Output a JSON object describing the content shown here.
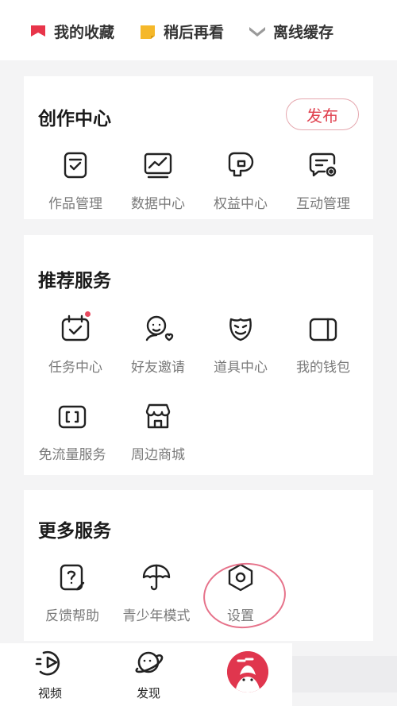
{
  "quick_links": [
    {
      "label": "我的收藏",
      "icon": "bookmark-icon",
      "color": "#e8354a"
    },
    {
      "label": "稍后再看",
      "icon": "watch-later-icon",
      "color": "#f5b82a"
    },
    {
      "label": "离线缓存",
      "icon": "offline-download-icon",
      "color": "#9a9a9a"
    }
  ],
  "creation": {
    "title": "创作中心",
    "publish_label": "发布",
    "items": [
      {
        "label": "作品管理",
        "icon": "works-manage-icon"
      },
      {
        "label": "数据中心",
        "icon": "data-chart-icon"
      },
      {
        "label": "权益中心",
        "icon": "benefits-icon"
      },
      {
        "label": "互动管理",
        "icon": "interaction-settings-icon"
      }
    ]
  },
  "recommended": {
    "title": "推荐服务",
    "items": [
      {
        "label": "任务中心",
        "icon": "task-calendar-icon"
      },
      {
        "label": "好友邀请",
        "icon": "invite-friend-icon"
      },
      {
        "label": "道具中心",
        "icon": "props-mask-icon"
      },
      {
        "label": "我的钱包",
        "icon": "wallet-icon"
      },
      {
        "label": "免流量服务",
        "icon": "data-free-sim-icon"
      },
      {
        "label": "周边商城",
        "icon": "store-icon"
      }
    ]
  },
  "more": {
    "title": "更多服务",
    "items": [
      {
        "label": "反馈帮助",
        "icon": "feedback-help-icon"
      },
      {
        "label": "青少年模式",
        "icon": "teen-mode-umbrella-icon"
      },
      {
        "label": "设置",
        "icon": "settings-hexagon-icon"
      }
    ]
  },
  "tabbar": {
    "items": [
      {
        "label": "视频",
        "icon": "video-play-icon"
      },
      {
        "label": "发现",
        "icon": "discover-planet-icon"
      },
      {
        "label": "",
        "icon": "avatar-icon"
      }
    ]
  },
  "colors": {
    "accent": "#e0414f",
    "highlight_ring": "#e6728a",
    "label_gray": "#7a7a7a",
    "background": "#f4f4f5"
  }
}
